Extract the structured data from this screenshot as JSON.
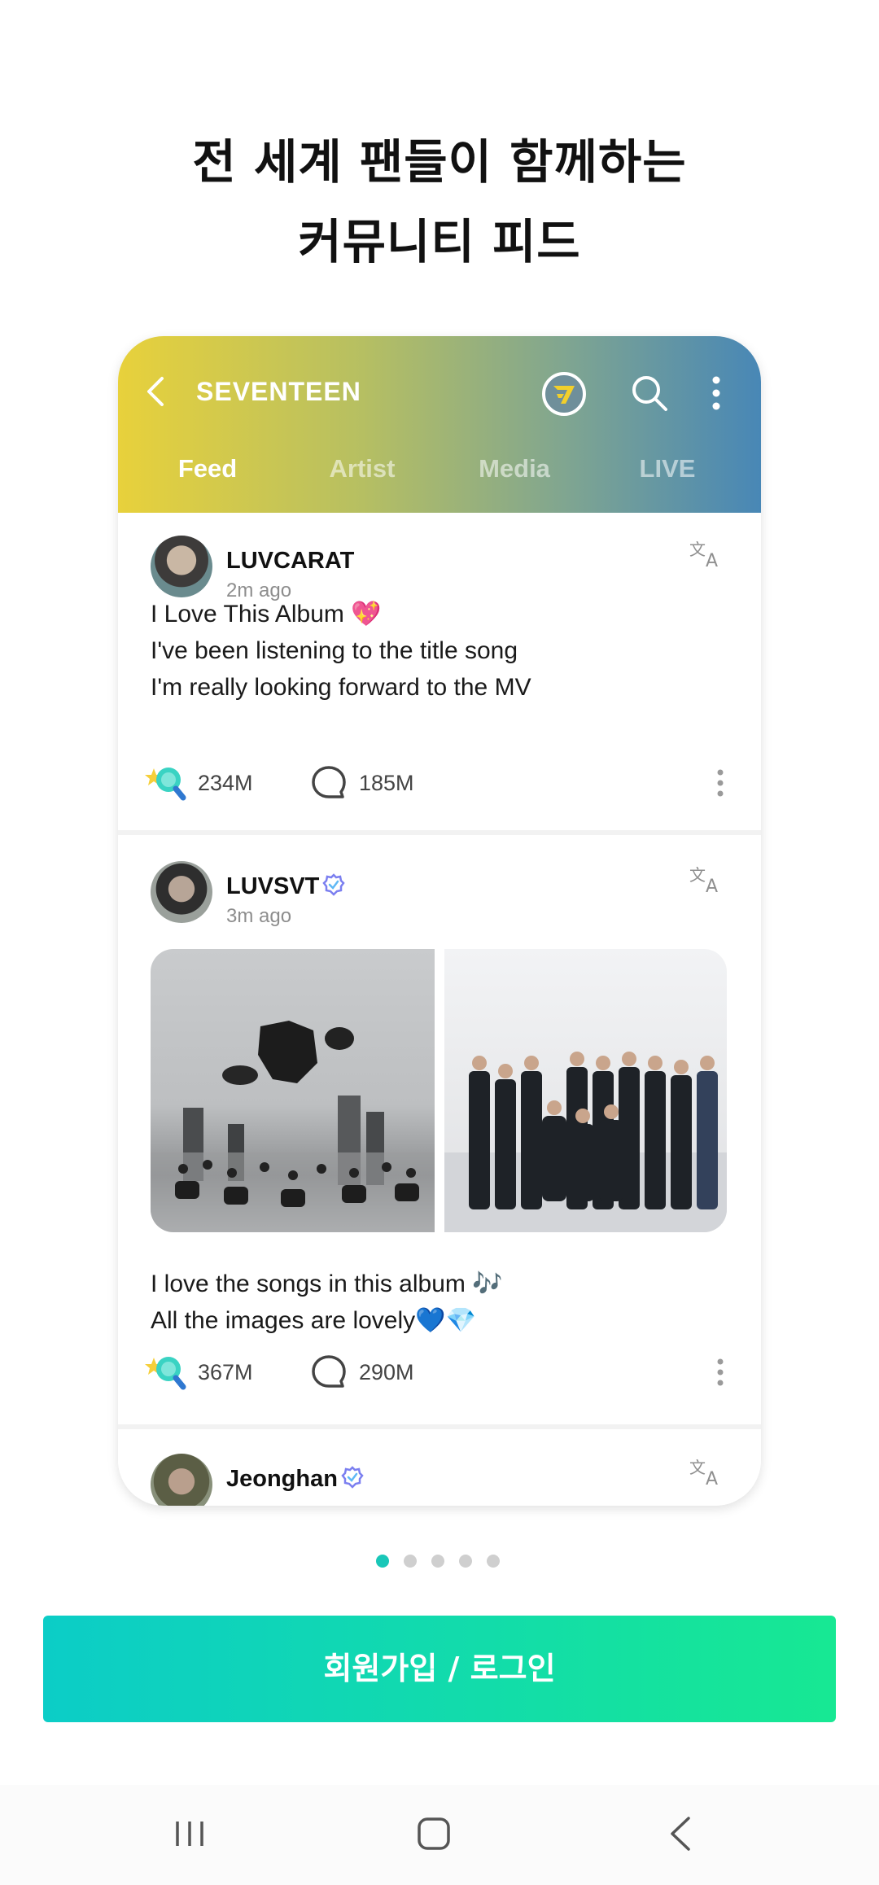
{
  "headline": {
    "line1": "전 세계 팬들이 함께하는",
    "line2": "커뮤니티 피드"
  },
  "community": {
    "name": "SEVENTEEN",
    "tabs": [
      {
        "label": "Feed",
        "active": true
      },
      {
        "label": "Artist",
        "active": false
      },
      {
        "label": "Media",
        "active": false
      },
      {
        "label": "LIVE",
        "active": false
      }
    ]
  },
  "posts": [
    {
      "username": "LUVCARAT",
      "time": "2m ago",
      "verified": false,
      "lines": [
        "I Love This Album 💖",
        "I've been listening to the title song",
        "I'm really looking forward to the MV"
      ],
      "likes": "234M",
      "comments": "185M"
    },
    {
      "username": "LUVSVT",
      "time": "3m ago",
      "verified": true,
      "lines": [
        "I love the songs in this album 🎶",
        "All the images are lovely💙💎"
      ],
      "likes": "367M",
      "comments": "290M"
    },
    {
      "username": "Jeonghan",
      "verified": true
    }
  ],
  "pager": {
    "count": 5,
    "active_index": 0
  },
  "cta": {
    "label": "회원가입 / 로그인"
  },
  "colors": {
    "accent": "#19c7b8",
    "cta_start": "#0ccdc7",
    "cta_end": "#17e893",
    "header_start": "#e8d13b",
    "header_end": "#4887b6"
  },
  "icons": [
    "back-chevron-icon",
    "seventeen-logo-icon",
    "search-icon",
    "more-vertical-icon",
    "translate-icon",
    "lightstick-like-icon",
    "comment-icon",
    "verified-badge-icon",
    "recent-apps-icon",
    "home-icon",
    "nav-back-icon"
  ]
}
